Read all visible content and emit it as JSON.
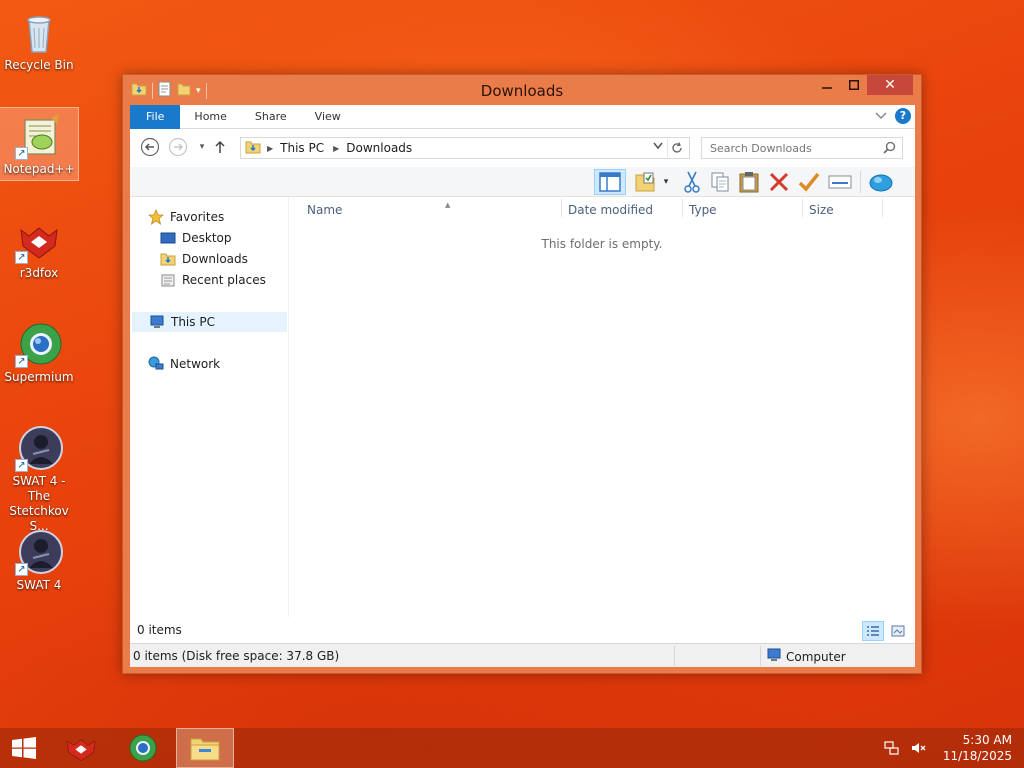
{
  "desktop": {
    "icons": [
      {
        "label": "Recycle Bin",
        "icon": "recycle-bin-icon"
      },
      {
        "label": "Notepad++",
        "icon": "notepad-plus-plus-icon",
        "selected": true
      },
      {
        "label": "r3dfox",
        "icon": "r3dfox-icon"
      },
      {
        "label": "Supermium",
        "icon": "supermium-icon"
      },
      {
        "label": "SWAT 4 - The Stetchkov S...",
        "icon": "swat4-tsk-icon"
      },
      {
        "label": "SWAT 4",
        "icon": "swat4-icon"
      }
    ]
  },
  "window": {
    "title": "Downloads",
    "ribbon_tabs": [
      "File",
      "Home",
      "Share",
      "View"
    ],
    "breadcrumb": [
      "This PC",
      "Downloads"
    ],
    "search": {
      "placeholder": "Search Downloads"
    },
    "navigation": {
      "favorites_label": "Favorites",
      "favorites": [
        "Desktop",
        "Downloads",
        "Recent places"
      ],
      "this_pc_label": "This PC",
      "network_label": "Network"
    },
    "columns": [
      "Name",
      "Date modified",
      "Type",
      "Size"
    ],
    "empty_message": "This folder is empty.",
    "items_count": "0 items",
    "status": {
      "left": "0 items (Disk free space: 37.8 GB)",
      "right": "Computer"
    }
  },
  "taskbar": {
    "pinned": [
      "start-button",
      "r3dfox",
      "supermium",
      "file-explorer"
    ],
    "active": "file-explorer",
    "clock_time": "5:30 AM",
    "clock_date": "11/18/2025"
  },
  "colors": {
    "accent": "#1979ca",
    "window_frame": "#ea7c4a",
    "close_button": "#c7473b",
    "desktop": "#e9440d"
  }
}
